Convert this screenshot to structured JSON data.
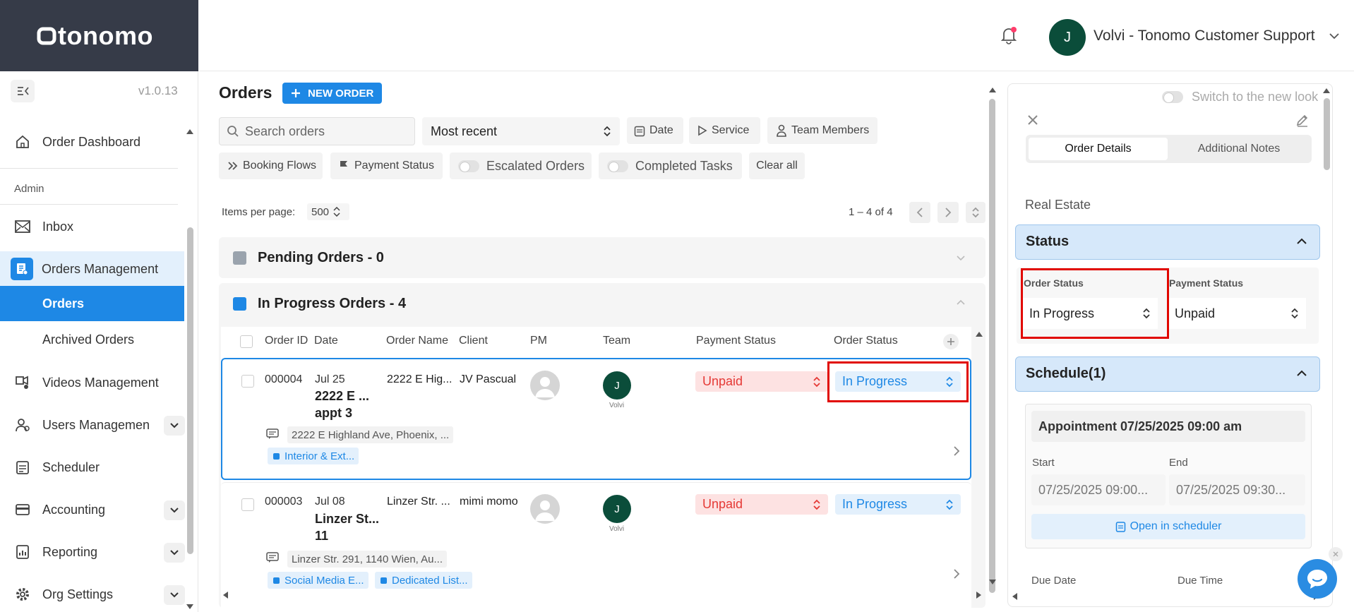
{
  "app": {
    "logo": "tonomo",
    "version": "v1.0.13"
  },
  "header": {
    "user_initial": "J",
    "user_name": "Volvi - Tonomo Customer Support"
  },
  "sidebar": {
    "admin_label": "Admin",
    "items": {
      "order_dashboard": "Order Dashboard",
      "inbox": "Inbox",
      "orders_management": "Orders Management",
      "orders": "Orders",
      "archived_orders": "Archived Orders",
      "videos_management": "Videos Management",
      "users_management": "Users Managemen",
      "scheduler": "Scheduler",
      "accounting": "Accounting",
      "reporting": "Reporting",
      "org_settings": "Org Settings"
    }
  },
  "main": {
    "title": "Orders",
    "new_order_label": "NEW ORDER",
    "search_placeholder": "Search orders",
    "sort_value": "Most recent",
    "filters": {
      "date": "Date",
      "service": "Service",
      "team_members": "Team Members",
      "booking_flows": "Booking Flows",
      "payment_status": "Payment Status",
      "escalated_orders": "Escalated Orders",
      "completed_tasks": "Completed Tasks",
      "clear_all": "Clear all"
    },
    "items_per_page_label": "Items per page:",
    "items_per_page_value": "500",
    "range": "1 – 4 of 4",
    "groups": {
      "pending": "Pending Orders - 0",
      "in_progress": "In Progress Orders - 4"
    },
    "columns": [
      "Order ID",
      "Date",
      "Order Name",
      "Client",
      "PM",
      "Team",
      "Payment Status",
      "Order Status"
    ],
    "orders": [
      {
        "id": "000004",
        "date": "Jul 25",
        "name_l1": "2222 E ...",
        "name_l2": "appt 3",
        "order_name": "2222 E Hig...",
        "client": "JV Pascual",
        "team_initial": "J",
        "team_name": "Volvi",
        "payment": "Unpaid",
        "status": "In Progress",
        "address": "2222 E Highland Ave, Phoenix, ...",
        "tags": [
          "Interior & Ext..."
        ]
      },
      {
        "id": "000003",
        "date": "Jul 08",
        "name_l1": "Linzer St...",
        "name_l2": "11",
        "order_name": "Linzer Str. ...",
        "client": "mimi momo",
        "team_initial": "J",
        "team_name": "Volvi",
        "payment": "Unpaid",
        "status": "In Progress",
        "address": "Linzer Str. 291, 1140 Wien, Au...",
        "tags": [
          "Social Media E...",
          "Dedicated List..."
        ]
      }
    ]
  },
  "panel": {
    "switch_label": "Switch to the new look",
    "tab_details": "Order Details",
    "tab_notes": "Additional Notes",
    "category": "Real Estate",
    "status_section": "Status",
    "order_status_label": "Order Status",
    "order_status_value": "In Progress",
    "payment_status_label": "Payment Status",
    "payment_status_value": "Unpaid",
    "schedule_section": "Schedule(1)",
    "appointment": "Appointment 07/25/2025 09:00 am",
    "start_label": "Start",
    "end_label": "End",
    "start_value": "07/25/2025 09:00...",
    "end_value": "07/25/2025 09:30...",
    "open_scheduler": "Open in scheduler",
    "due_date_label": "Due Date",
    "due_time_label": "Due Time"
  },
  "colors": {
    "accent": "#1e88e5",
    "sidebar_dark": "#363b48",
    "unpaid_bg": "#fde2e2",
    "unpaid_text": "#e53935",
    "highlight": "#e10600"
  }
}
